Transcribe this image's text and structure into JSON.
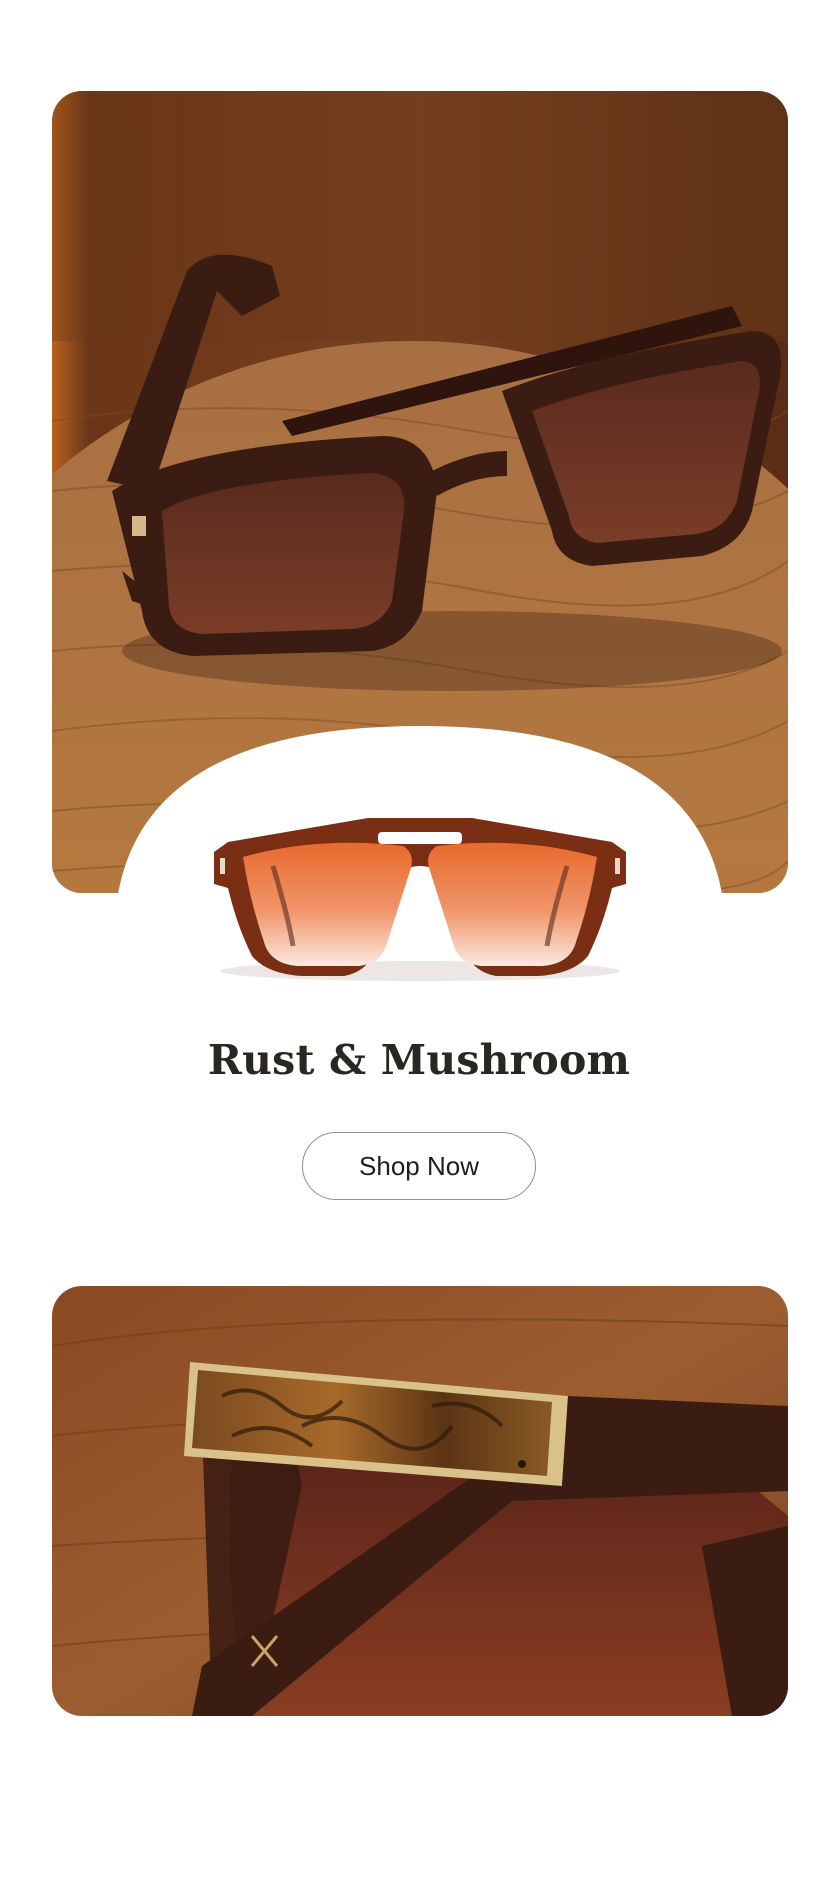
{
  "product": {
    "name": "Rust & Mushroom",
    "cta_label": "Shop Now"
  },
  "images": {
    "hero": "hero-sunglasses-on-wood-table",
    "product": "front-view-sunglasses",
    "detail": "temple-detail-closeup"
  },
  "colors": {
    "frame": "#3b1c12",
    "lens": "#e87a3c",
    "wood": "#a8673a",
    "title": "#2a2723"
  }
}
